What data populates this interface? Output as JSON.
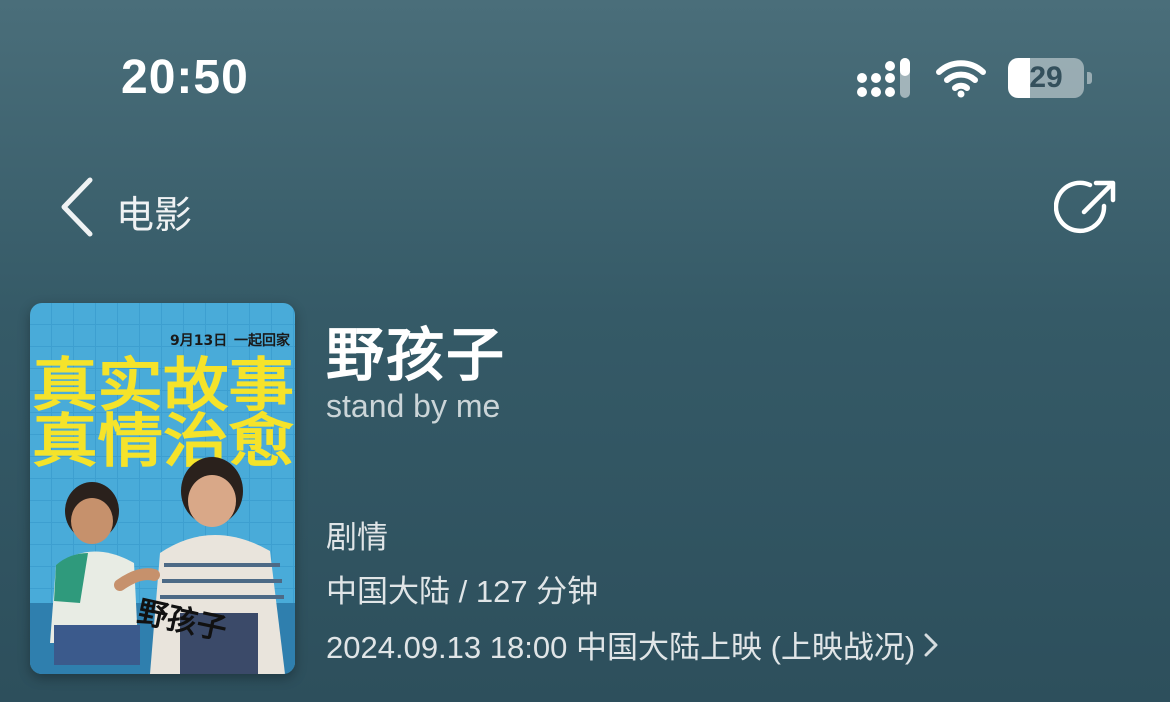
{
  "status_bar": {
    "time": "20:50",
    "battery_level": "29",
    "battery_fraction": 0.29
  },
  "nav": {
    "back_label": "电影",
    "back_icon": "chevron-left-icon",
    "share_icon": "share-icon"
  },
  "movie": {
    "title": "野孩子",
    "english_title": "stand by me",
    "genre": "剧情",
    "region_duration": "中国大陆 / 127 分钟",
    "release_info": "2024.09.13 18:00 中国大陆上映 (上映战况)"
  },
  "poster": {
    "date_text": "9月13日",
    "slogan_top": "一起回家",
    "headline_1": "真实故事",
    "headline_2": "真情治愈",
    "logo_text": "野孩子"
  },
  "colors": {
    "poster_tile_blue": "#3d9fd0",
    "poster_yellow": "#f5e32a"
  }
}
